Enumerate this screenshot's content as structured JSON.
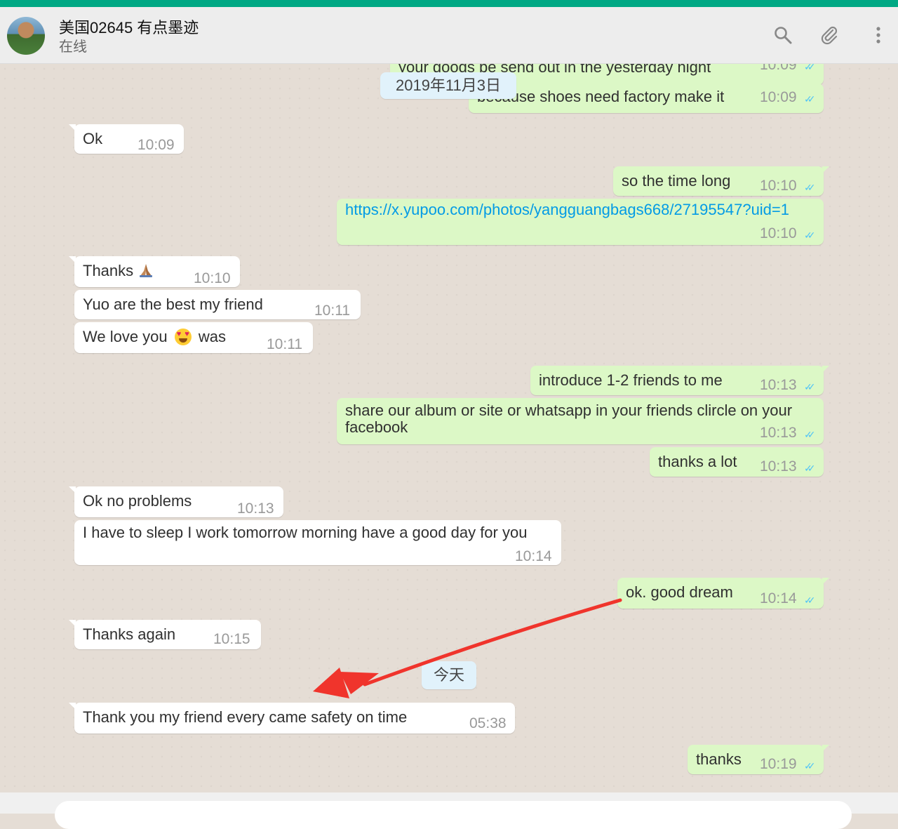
{
  "header": {
    "contact_name": "美国02645 有点墨迹",
    "status": "在线",
    "icons": [
      "search-icon",
      "attach-icon",
      "menu-icon"
    ]
  },
  "dates": {
    "first": "2019年11月3日",
    "today": "今天"
  },
  "messages": [
    {
      "dir": "out",
      "text": "your goods be send out in the yesterday night",
      "time": "10:09"
    },
    {
      "dir": "out",
      "text": "because shoes need factory make it",
      "time": "10:09"
    },
    {
      "dir": "in",
      "text": "Ok",
      "time": "10:09"
    },
    {
      "dir": "out",
      "text": "so the time long",
      "time": "10:10"
    },
    {
      "dir": "out",
      "text": "https://x.yupoo.com/photos/yangguangbags668/27195547?uid=1",
      "time": "10:10"
    },
    {
      "dir": "in",
      "text": "Thanks",
      "emoji": "folded-hands",
      "time": "10:10"
    },
    {
      "dir": "in",
      "text": "Yuo are the best my friend",
      "time": "10:11"
    },
    {
      "dir": "in",
      "text_before": "We love you",
      "emoji": "heart-eyes",
      "text_after": "was",
      "time": "10:11"
    },
    {
      "dir": "out",
      "text": "introduce 1-2 friends to me",
      "time": "10:13"
    },
    {
      "dir": "out",
      "text": "share our album or site or whatsapp in your friends clircle  on your facebook",
      "time": "10:13"
    },
    {
      "dir": "out",
      "text": "thanks a lot",
      "time": "10:13"
    },
    {
      "dir": "in",
      "text": "Ok no problems",
      "time": "10:13"
    },
    {
      "dir": "in",
      "text": "I have to sleep I work tomorrow morning have a good day for you",
      "time": "10:14"
    },
    {
      "dir": "out",
      "text": "ok. good dream",
      "time": "10:14"
    },
    {
      "dir": "in",
      "text": "Thanks again",
      "time": "10:15"
    },
    {
      "dir": "in",
      "text": "Thank you my friend every came safety on time",
      "time": "05:38"
    },
    {
      "dir": "out",
      "text": "thanks",
      "time": "10:19"
    }
  ],
  "annotation": {
    "arrow_color": "#f0342c"
  },
  "colors": {
    "incoming": "#ffffff",
    "outgoing": "#dcf8c6",
    "accent": "#00a884",
    "read_ticks": "#4fc3f7"
  }
}
